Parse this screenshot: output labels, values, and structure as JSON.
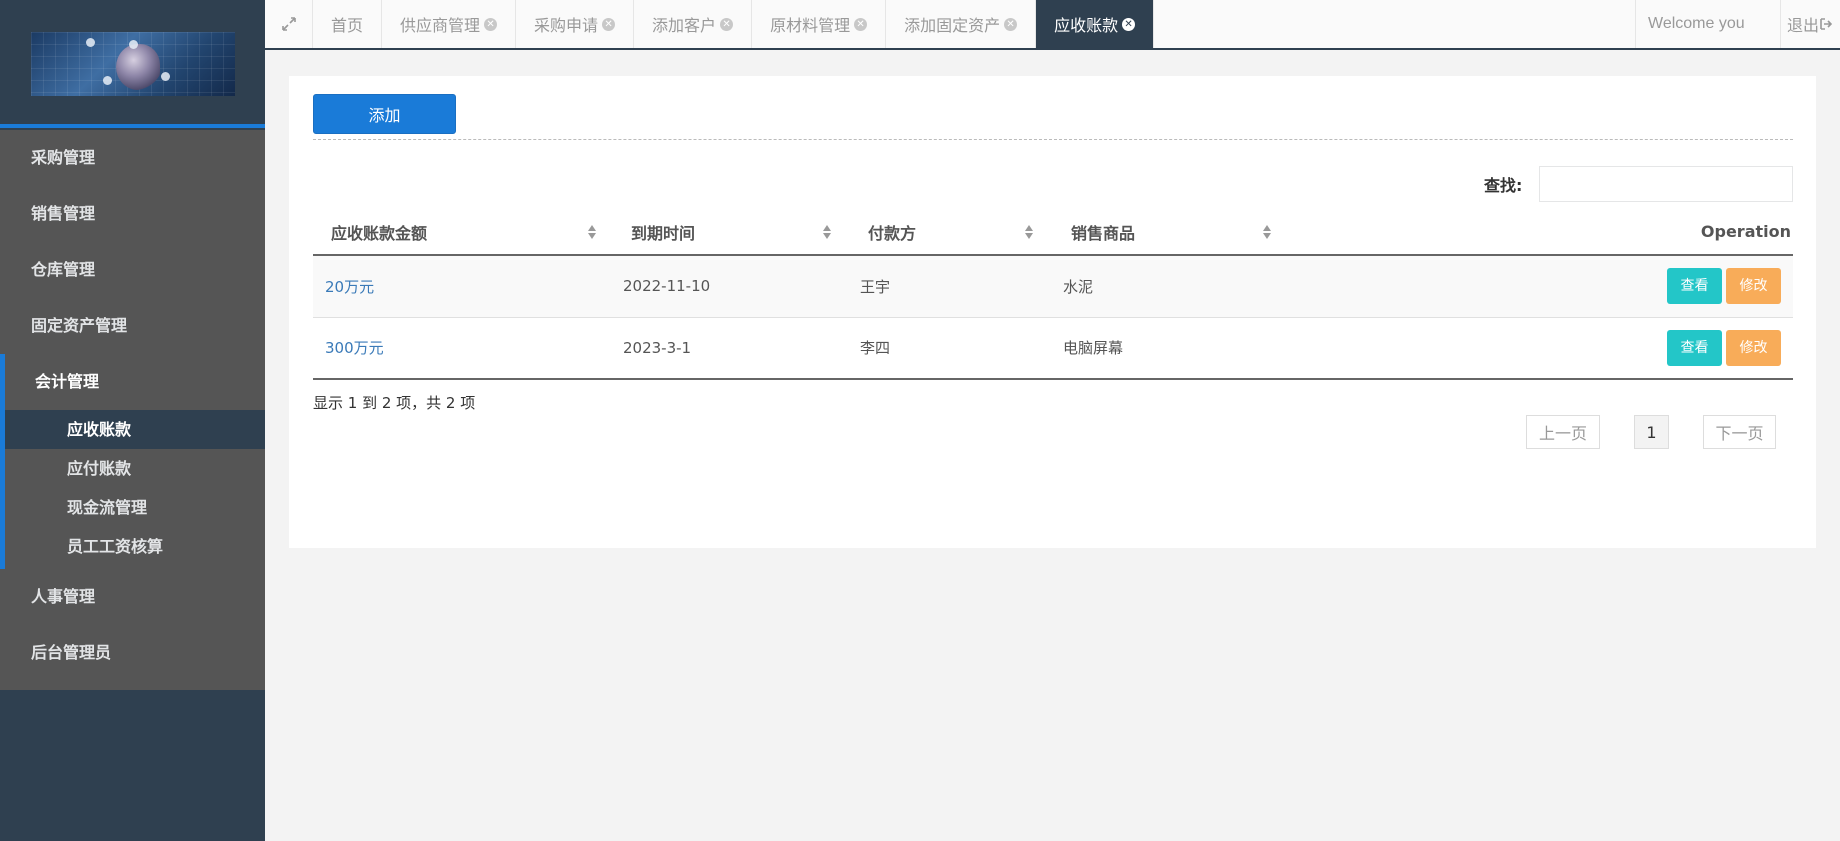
{
  "sidebar": {
    "menu": [
      {
        "label": "采购管理"
      },
      {
        "label": "销售管理"
      },
      {
        "label": "仓库管理"
      },
      {
        "label": "固定资产管理"
      }
    ],
    "active_group": {
      "label": "会计管理",
      "items": [
        {
          "label": "应收账款",
          "active": true
        },
        {
          "label": "应付账款"
        },
        {
          "label": "现金流管理"
        },
        {
          "label": "员工工资核算"
        }
      ]
    },
    "menu_after": [
      {
        "label": "人事管理"
      },
      {
        "label": "后台管理员"
      }
    ]
  },
  "topbar": {
    "tabs": [
      {
        "label": "首页",
        "closable": false
      },
      {
        "label": "供应商管理",
        "closable": true
      },
      {
        "label": "采购申请",
        "closable": true
      },
      {
        "label": "添加客户",
        "closable": true
      },
      {
        "label": "原材料管理",
        "closable": true
      },
      {
        "label": "添加固定资产",
        "closable": true
      },
      {
        "label": "应收账款",
        "closable": true,
        "active": true
      }
    ],
    "welcome": "Welcome you",
    "logout": "退出"
  },
  "main": {
    "add_label": "添加",
    "search_label": "查找:",
    "search_value": "",
    "table": {
      "columns": [
        "应收账款金额",
        "到期时间",
        "付款方",
        "销售商品",
        "Operation"
      ],
      "rows": [
        {
          "amount": "20万元",
          "due": "2022-11-10",
          "payer": "王宇",
          "product": "水泥"
        },
        {
          "amount": "300万元",
          "due": "2023-3-1",
          "payer": "李四",
          "product": "电脑屏幕"
        }
      ],
      "view_label": "查看",
      "edit_label": "修改"
    },
    "page_info": "显示 1 到 2 项，共 2 项",
    "pager": {
      "prev": "上一页",
      "current": "1",
      "next": "下一页"
    }
  },
  "colors": {
    "sidebar_bg": "#2f4050",
    "accent": "#1a7bd8",
    "view_btn": "#23c6c8",
    "edit_btn": "#f8ac59"
  }
}
